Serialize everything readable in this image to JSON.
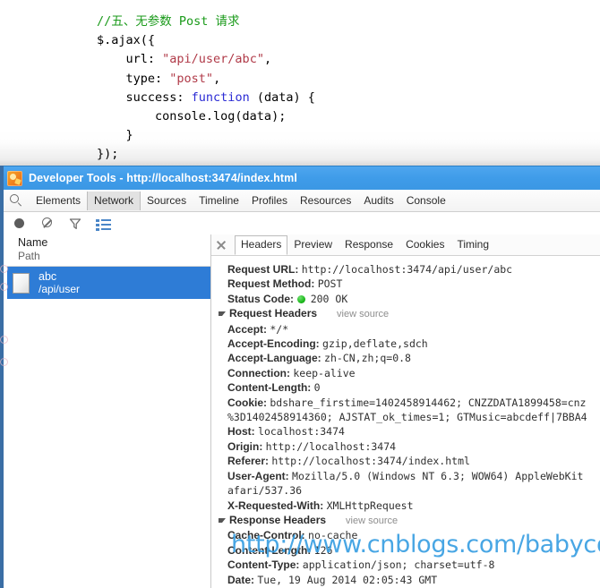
{
  "code_snippet": {
    "lines": [
      [
        {
          "t": "comment",
          "s": "//五、无参数 Post 请求"
        }
      ],
      [
        {
          "t": "plain",
          "s": "$.ajax({"
        }
      ],
      [
        {
          "t": "plain",
          "s": "    url: "
        },
        {
          "t": "str",
          "s": "\"api/user/abc\""
        },
        {
          "t": "plain",
          "s": ","
        }
      ],
      [
        {
          "t": "plain",
          "s": "    type: "
        },
        {
          "t": "str",
          "s": "\"post\""
        },
        {
          "t": "plain",
          "s": ","
        }
      ],
      [
        {
          "t": "plain",
          "s": "    success: "
        },
        {
          "t": "kw",
          "s": "function"
        },
        {
          "t": "plain",
          "s": " (data) {"
        }
      ],
      [
        {
          "t": "plain",
          "s": "        console.log(data);"
        }
      ],
      [
        {
          "t": "plain",
          "s": "    }"
        }
      ],
      [
        {
          "t": "plain",
          "s": "});"
        }
      ]
    ]
  },
  "window": {
    "title": "Developer Tools - http://localhost:3474/index.html",
    "app_icon": "devtools-app-icon"
  },
  "panel_tabs": {
    "search_icon": "search-icon",
    "items": [
      {
        "label": "Elements",
        "selected": false
      },
      {
        "label": "Network",
        "selected": true
      },
      {
        "label": "Sources",
        "selected": false
      },
      {
        "label": "Timeline",
        "selected": false
      },
      {
        "label": "Profiles",
        "selected": false
      },
      {
        "label": "Resources",
        "selected": false
      },
      {
        "label": "Audits",
        "selected": false
      },
      {
        "label": "Console",
        "selected": false
      }
    ]
  },
  "network_toolbar": {
    "icons": [
      "record-icon",
      "clear-icon",
      "filter-icon",
      "large-rows-icon"
    ]
  },
  "requests_pane": {
    "header_name": "Name",
    "header_path": "Path",
    "rows": [
      {
        "name": "abc",
        "path": "/api/user",
        "selected": true,
        "icon": "document-icon"
      }
    ]
  },
  "details_pane": {
    "close_icon": "close-icon",
    "tabs": [
      {
        "label": "Headers",
        "selected": true
      },
      {
        "label": "Preview",
        "selected": false
      },
      {
        "label": "Response",
        "selected": false
      },
      {
        "label": "Cookies",
        "selected": false
      },
      {
        "label": "Timing",
        "selected": false
      }
    ],
    "general": [
      {
        "key": "Request URL:",
        "value": "http://localhost:3474/api/user/abc"
      },
      {
        "key": "Request Method:",
        "value": "POST"
      },
      {
        "key": "Status Code:",
        "value": "200 OK",
        "status_dot": true
      }
    ],
    "request_headers": {
      "title": "Request Headers",
      "view_source": "view source",
      "expanded": true,
      "items": [
        {
          "key": "Accept:",
          "value": "*/*"
        },
        {
          "key": "Accept-Encoding:",
          "value": "gzip,deflate,sdch"
        },
        {
          "key": "Accept-Language:",
          "value": "zh-CN,zh;q=0.8"
        },
        {
          "key": "Connection:",
          "value": "keep-alive"
        },
        {
          "key": "Content-Length:",
          "value": "0"
        },
        {
          "key": "Cookie:",
          "value": "bdshare_firstime=1402458914462; CNZZDATA1899458=cnz",
          "continuation": "%3D1402458914360; AJSTAT_ok_times=1; GTMusic=abcdeff|7BBA4"
        },
        {
          "key": "Host:",
          "value": "localhost:3474"
        },
        {
          "key": "Origin:",
          "value": "http://localhost:3474"
        },
        {
          "key": "Referer:",
          "value": "http://localhost:3474/index.html"
        },
        {
          "key": "User-Agent:",
          "value": "Mozilla/5.0 (Windows NT 6.3; WOW64) AppleWebKit",
          "continuation": "afari/537.36"
        },
        {
          "key": "X-Requested-With:",
          "value": "XMLHttpRequest"
        }
      ]
    },
    "response_headers": {
      "title": "Response Headers",
      "view_source": "view source",
      "expanded": true,
      "items": [
        {
          "key": "Cache-Control:",
          "value": "no-cache"
        },
        {
          "key": "Content-Length:",
          "value": "126"
        },
        {
          "key": "Content-Type:",
          "value": "application/json; charset=utf-8"
        },
        {
          "key": "Date:",
          "value": "Tue, 19 Aug 2014 02:05:43 GMT"
        }
      ]
    }
  },
  "watermark": {
    "text": "http://www.cnblogs.com/babycool",
    "color": "#3ba0e3"
  }
}
